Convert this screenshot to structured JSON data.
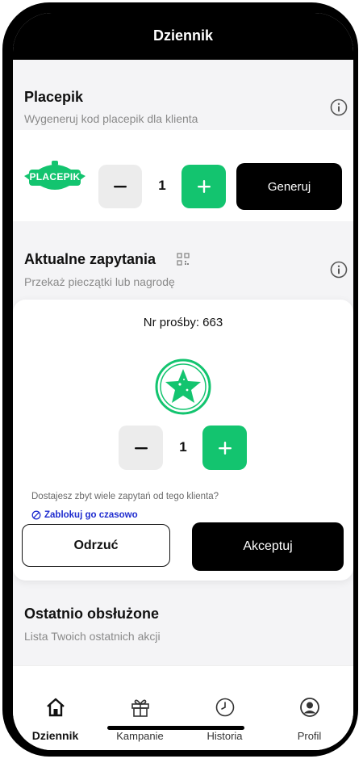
{
  "header": {
    "title": "Dziennik"
  },
  "placepik": {
    "title": "Placepik",
    "subtitle": "Wygeneruj kod placepik dla klienta",
    "logo_text": "PLACEPIK",
    "quantity": "1",
    "generate_label": "Generuj"
  },
  "requests": {
    "title": "Aktualne zapytania",
    "subtitle": "Przekaż pieczątki lub nagrodę",
    "card": {
      "request_label": "Nr prośby: 663",
      "quantity": "1",
      "warning": "Dostajesz zbyt wiele zapytań od tego klienta?",
      "block_label": "Zablokuj go czasowo",
      "reject_label": "Odrzuć",
      "accept_label": "Akceptuj"
    }
  },
  "recent": {
    "title": "Ostatnio obsłużone",
    "subtitle": "Lista Twoich ostatnich akcji"
  },
  "nav": {
    "items": [
      {
        "label": "Dziennik",
        "icon": "home-icon",
        "active": true
      },
      {
        "label": "Kampanie",
        "icon": "gift-icon",
        "active": false
      },
      {
        "label": "Historia",
        "icon": "clock-icon",
        "active": false
      },
      {
        "label": "Profil",
        "icon": "user-icon",
        "active": false
      }
    ]
  },
  "colors": {
    "accent": "#13c46f",
    "dark": "#000000",
    "muted": "#8a8a8a",
    "link": "#1f2ccf"
  }
}
